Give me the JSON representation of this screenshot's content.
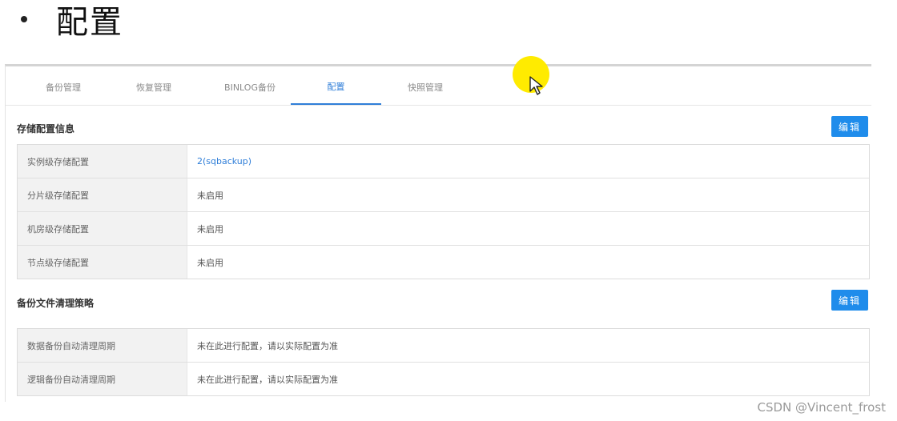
{
  "slide": {
    "bullet": "•",
    "heading": "配置"
  },
  "tabs": [
    {
      "label": "备份管理",
      "active": false
    },
    {
      "label": "恢复管理",
      "active": false
    },
    {
      "label": "BINLOG备份",
      "active": false
    },
    {
      "label": "配置",
      "active": true
    },
    {
      "label": "快照管理",
      "active": false
    }
  ],
  "storage": {
    "title": "存储配置信息",
    "edit_label": "编辑",
    "rows": [
      {
        "key": "实例级存储配置",
        "value": "2(sqbackup)"
      },
      {
        "key": "分片级存储配置",
        "value": "未启用"
      },
      {
        "key": "机房级存储配置",
        "value": "未启用"
      },
      {
        "key": "节点级存储配置",
        "value": "未启用"
      }
    ]
  },
  "cleanup": {
    "title": "备份文件清理策略",
    "edit_label": "编辑",
    "rows": [
      {
        "key": "数据备份自动清理周期",
        "value": "未在此进行配置，请以实际配置为准"
      },
      {
        "key": "逻辑备份自动清理周期",
        "value": "未在此进行配置，请以实际配置为准"
      }
    ]
  },
  "watermark": "CSDN @Vincent_frost",
  "colors": {
    "accent": "#2f7ed8",
    "button": "#1f8ceb",
    "cursor_highlight": "#ffeb00"
  }
}
